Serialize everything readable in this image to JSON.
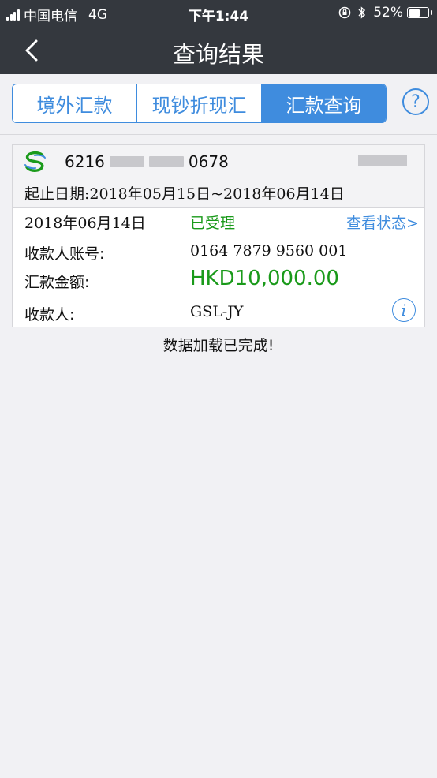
{
  "status_bar": {
    "carrier": "中国电信",
    "network": "4G",
    "time": "下午1:44",
    "battery": "52%",
    "battery_level": 0.52
  },
  "nav": {
    "title": "查询结果",
    "back_icon": "chevron-left-icon"
  },
  "tabs": [
    {
      "label": "境外汇款",
      "active": false
    },
    {
      "label": "现钞折现汇",
      "active": false
    },
    {
      "label": "汇款查询",
      "active": true
    }
  ],
  "help_icon": "?",
  "card": {
    "card_prefix": "6216",
    "card_suffix": "0678",
    "date_range": "起止日期:2018年05月15日~2018年06月14日",
    "transaction": {
      "date": "2018年06月14日",
      "status": "已受理",
      "view_status": "查看状态>",
      "account_label": "收款人账号:",
      "account_value": "0164 7879 9560 001",
      "amount_label": "汇款金额:",
      "amount_value": "HKD10,000.00",
      "payee_label": "收款人:",
      "payee_value": "GSL-JY",
      "info_icon": "i"
    }
  },
  "footer": {
    "load_complete": "数据加载已完成!"
  },
  "colors": {
    "header_bg": "#34383e",
    "accent": "#3f8cde",
    "success": "#1a9a1a"
  }
}
